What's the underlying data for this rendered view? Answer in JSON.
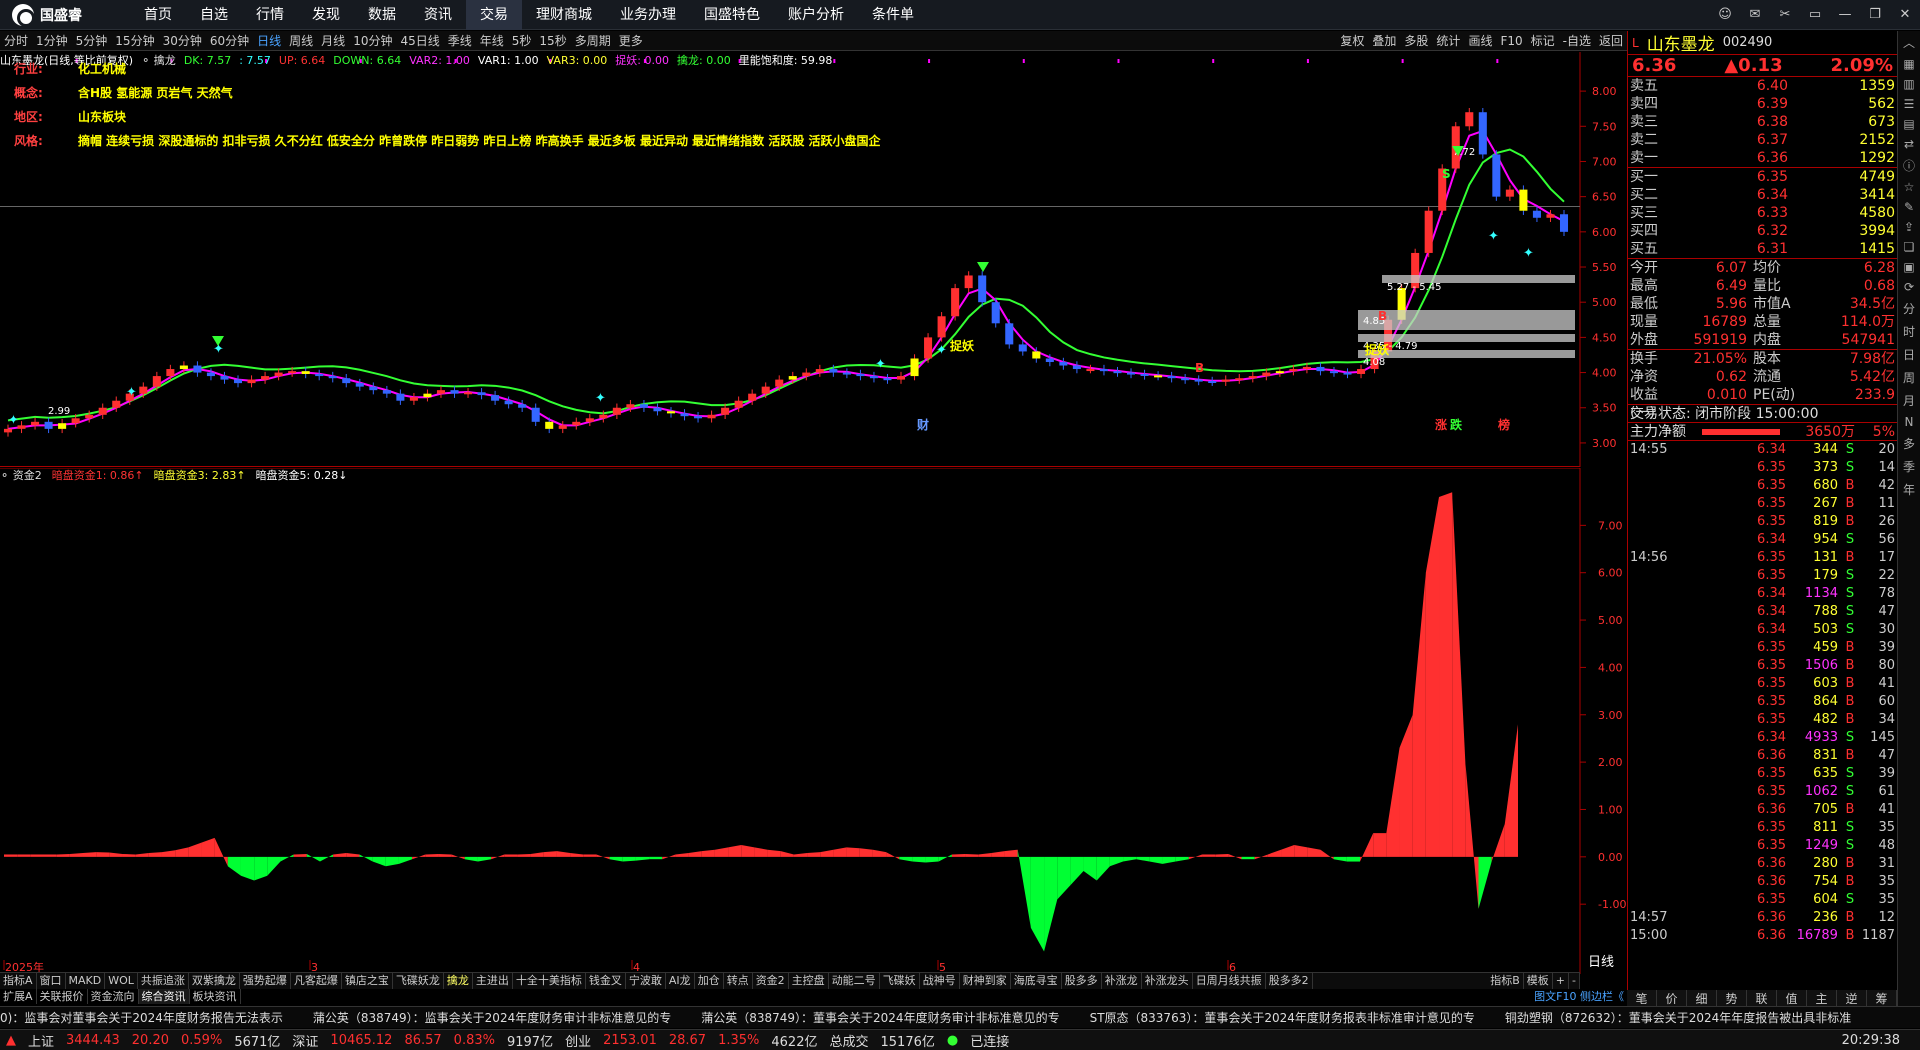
{
  "app": {
    "logo_text": "国盛睿"
  },
  "nav": [
    "首页",
    "自选",
    "行情",
    "发现",
    "数据",
    "资讯",
    "交易",
    "理财商城",
    "业务办理",
    "国盛特色",
    "账户分析",
    "条件单"
  ],
  "nav_active": 6,
  "window_icons": [
    "chat-icon",
    "mail-icon",
    "tools-icon",
    "screen-icon",
    "minimize-icon",
    "restore-icon",
    "close-icon"
  ],
  "periods": [
    "分时",
    "1分钟",
    "5分钟",
    "15分钟",
    "30分钟",
    "60分钟",
    "日线",
    "周线",
    "月线",
    "10分钟",
    "45日线",
    "季线",
    "年线",
    "5秒",
    "15秒",
    "多周期",
    "更多"
  ],
  "period_selected": 6,
  "tools": [
    "复权",
    "叠加",
    "多股",
    "统计",
    "画线",
    "F10",
    "标记",
    "-自选",
    "返回"
  ],
  "main_title": [
    {
      "t": "山东墨龙(日线,等比前复权)",
      "c": "#ffffff"
    },
    {
      "t": "⚬ 擒龙",
      "c": "#dddddd"
    },
    {
      "t": "DK: 7.57",
      "c": "#33ff33"
    },
    {
      "t": ": 7.57",
      "c": "#33ffff"
    },
    {
      "t": "UP: 6.64",
      "c": "#ff3333"
    },
    {
      "t": "DOWN: 6.64",
      "c": "#33ff33"
    },
    {
      "t": "VAR2: 1.00",
      "c": "#ff33ff"
    },
    {
      "t": "VAR1: 1.00",
      "c": "#ffffff"
    },
    {
      "t": "VAR3: 0.00",
      "c": "#ffff33"
    },
    {
      "t": "捉妖: 0.00",
      "c": "#ff33ff"
    },
    {
      "t": "擒龙: 0.00",
      "c": "#33ff33"
    },
    {
      "t": "里能饱和度: 59.98",
      "c": "#ffffff"
    }
  ],
  "stock_info": [
    {
      "k": "行业:",
      "v": "化工机械"
    },
    {
      "k": "概念:",
      "v": "含H股 氢能源 页岩气 天然气"
    },
    {
      "k": "地区:",
      "v": "山东板块"
    },
    {
      "k": "风格:",
      "v": "摘帽 连续亏损 深股通标的 扣非亏损 久不分红 低安全分 昨曾跌停 昨日弱势 昨日上榜 昨高换手 最近多板 最近异动 最近情绪指数 活跃股 活跃小盘国企"
    }
  ],
  "main_axis_ticks": [
    "8.00",
    "7.50",
    "7.00",
    "6.50",
    "6.00",
    "5.50",
    "5.00",
    "4.50",
    "4.00",
    "3.50",
    "3.00"
  ],
  "price_labels": {
    "high": "7.72",
    "low": "2.99",
    "box1": "5.27 - 5.45",
    "box2": "4.85",
    "box3": "4.35 - 4.79",
    "box4": "4.08"
  },
  "chart_markers": {
    "yao1": "捉妖",
    "yao2": "捉妖",
    "cai": "财",
    "zhang": "涨",
    "die": "跌",
    "bang": "榜",
    "b1": "B",
    "b2": "B",
    "s": "S",
    "b3": "B"
  },
  "sub_title": [
    {
      "t": "⚬ 资金2",
      "c": "#dddddd"
    },
    {
      "t": "暗盘资金1: 0.86↑",
      "c": "#ff3333"
    },
    {
      "t": "暗盘资金3: 2.83↑",
      "c": "#ffff33"
    },
    {
      "t": "暗盘资金5: 0.28↓",
      "c": "#ffffff"
    }
  ],
  "sub_axis_ticks": [
    "7.00",
    "6.00",
    "5.00",
    "4.00",
    "3.00",
    "2.00",
    "1.00",
    "0.00",
    "-1.00"
  ],
  "date_labels": [
    "2025年",
    "3",
    "4",
    "5",
    "6"
  ],
  "period_label": "日线",
  "indicator_tabs": [
    "指标A",
    "窗口",
    "MAKD",
    "WOL",
    "共振追涨",
    "双紫擒龙",
    "强势起爆",
    "凡客起爆",
    "镇店之宝",
    "飞碟妖龙",
    "擒龙",
    "主进出",
    "十全十美指标",
    "钱金叉",
    "宁波敢",
    "AI龙",
    "加仓",
    "转点",
    "资金2",
    "主控盘",
    "动能二号",
    "飞碟妖",
    "战神号",
    "财神到家",
    "海底寻宝",
    "股多多",
    "补涨龙",
    "补涨龙头",
    "日周月线共振",
    "股多多2"
  ],
  "indicator_selected": 10,
  "indicator_right": [
    "指标B",
    "模板",
    "+",
    "-"
  ],
  "bottom_tabs": [
    "扩展A",
    "关联报价",
    "资金流向",
    "综合资讯",
    "板块资讯"
  ],
  "bottom_tab_selected": 3,
  "bottom_right": "图文F10 侧边栏《",
  "news": [
    "0)：监事会对董事会关于2024年度财务报告无法表示",
    "蒲公英（838749）：监事会关于2024年度财务审计非标准意见的专",
    "蒲公英（838749）：董事会关于2024年度财务审计非标准意见的专",
    "ST原态（833763）：董事会关于2024年度财务报表非标准审计意见的专",
    "铜劲塑钢（872632）：董事会关于2024年年度报告被出具非标准"
  ],
  "status": {
    "sh": {
      "name": "上证",
      "v": "3444.43",
      "chg": "20.20",
      "pct": "0.59%",
      "amt": "5671亿"
    },
    "sz": {
      "name": "深证",
      "v": "10465.12",
      "chg": "86.57",
      "pct": "0.83%",
      "amt": "9197亿"
    },
    "cy": {
      "name": "创业",
      "v": "2153.01",
      "chg": "28.67",
      "pct": "1.35%",
      "amt": "4622亿"
    },
    "total_label": "总成交",
    "total": "15176亿",
    "conn": "已连接",
    "time": "20:29:38"
  },
  "quote": {
    "flag": "L",
    "name": "山东墨龙",
    "code": "002490",
    "price": "6.36",
    "change": "▲0.13",
    "pct": "2.09%",
    "asks": [
      {
        "l": "卖五",
        "p": "6.40",
        "q": "1359"
      },
      {
        "l": "卖四",
        "p": "6.39",
        "q": "562"
      },
      {
        "l": "卖三",
        "p": "6.38",
        "q": "673"
      },
      {
        "l": "卖二",
        "p": "6.37",
        "q": "2152"
      },
      {
        "l": "卖一",
        "p": "6.36",
        "q": "1292"
      }
    ],
    "bids": [
      {
        "l": "买一",
        "p": "6.35",
        "q": "4749"
      },
      {
        "l": "买二",
        "p": "6.34",
        "q": "3414"
      },
      {
        "l": "买三",
        "p": "6.33",
        "q": "4580"
      },
      {
        "l": "买四",
        "p": "6.32",
        "q": "3994"
      },
      {
        "l": "买五",
        "p": "6.31",
        "q": "1415"
      }
    ],
    "stats": [
      {
        "a": "今开",
        "b": "6.07",
        "c": "均价",
        "d": "6.28"
      },
      {
        "a": "最高",
        "b": "6.49",
        "c": "量比",
        "d": "0.68"
      },
      {
        "a": "最低",
        "b": "5.96",
        "c": "市值A",
        "d": "34.5亿"
      },
      {
        "a": "现量",
        "b": "16789",
        "c": "总量",
        "d": "114.0万"
      },
      {
        "a": "外盘",
        "b": "591919",
        "c": "内盘",
        "d": "547941"
      }
    ],
    "stats2": [
      {
        "a": "换手",
        "b": "21.05%",
        "c": "股本",
        "d": "7.98亿"
      },
      {
        "a": "净资",
        "b": "0.62",
        "c": "流通",
        "d": "5.42亿"
      },
      {
        "a": "收益(一)",
        "b": "0.010",
        "c": "PE(动)",
        "d": "233.9"
      }
    ],
    "trade_status": "交易状态: 闭市阶段 15:00:00",
    "main_net_label": "主力净额",
    "main_net": "3650万",
    "main_net_pct": "5%"
  },
  "ticks": [
    {
      "t": "14:55",
      "p": "6.34",
      "v": "344",
      "s": "S",
      "n": "20"
    },
    {
      "t": "",
      "p": "6.35",
      "v": "373",
      "s": "S",
      "n": "14"
    },
    {
      "t": "",
      "p": "6.35",
      "v": "680",
      "s": "B",
      "n": "42"
    },
    {
      "t": "",
      "p": "6.35",
      "v": "267",
      "s": "B",
      "n": "11"
    },
    {
      "t": "",
      "p": "6.35",
      "v": "819",
      "s": "B",
      "n": "26"
    },
    {
      "t": "",
      "p": "6.34",
      "v": "954",
      "s": "S",
      "n": "56"
    },
    {
      "t": "14:56",
      "p": "6.35",
      "v": "131",
      "s": "B",
      "n": "17"
    },
    {
      "t": "",
      "p": "6.35",
      "v": "179",
      "s": "S",
      "n": "22"
    },
    {
      "t": "",
      "p": "6.34",
      "v": "1134",
      "s": "S",
      "n": "78"
    },
    {
      "t": "",
      "p": "6.34",
      "v": "788",
      "s": "S",
      "n": "47"
    },
    {
      "t": "",
      "p": "6.34",
      "v": "503",
      "s": "S",
      "n": "30"
    },
    {
      "t": "",
      "p": "6.35",
      "v": "459",
      "s": "B",
      "n": "39"
    },
    {
      "t": "",
      "p": "6.35",
      "v": "1506",
      "s": "B",
      "n": "80"
    },
    {
      "t": "",
      "p": "6.35",
      "v": "603",
      "s": "B",
      "n": "41"
    },
    {
      "t": "",
      "p": "6.35",
      "v": "864",
      "s": "B",
      "n": "60"
    },
    {
      "t": "",
      "p": "6.35",
      "v": "482",
      "s": "B",
      "n": "34"
    },
    {
      "t": "",
      "p": "6.34",
      "v": "4933",
      "s": "S",
      "n": "145"
    },
    {
      "t": "",
      "p": "6.36",
      "v": "831",
      "s": "B",
      "n": "47"
    },
    {
      "t": "",
      "p": "6.35",
      "v": "635",
      "s": "S",
      "n": "39"
    },
    {
      "t": "",
      "p": "6.35",
      "v": "1062",
      "s": "S",
      "n": "61"
    },
    {
      "t": "",
      "p": "6.36",
      "v": "705",
      "s": "B",
      "n": "41"
    },
    {
      "t": "",
      "p": "6.35",
      "v": "811",
      "s": "S",
      "n": "35"
    },
    {
      "t": "",
      "p": "6.35",
      "v": "1249",
      "s": "S",
      "n": "48"
    },
    {
      "t": "",
      "p": "6.36",
      "v": "280",
      "s": "B",
      "n": "31"
    },
    {
      "t": "",
      "p": "6.36",
      "v": "754",
      "s": "B",
      "n": "35"
    },
    {
      "t": "",
      "p": "6.35",
      "v": "604",
      "s": "S",
      "n": "35"
    },
    {
      "t": "14:57",
      "p": "6.36",
      "v": "236",
      "s": "B",
      "n": "12"
    },
    {
      "t": "15:00",
      "p": "6.36",
      "v": "16789",
      "s": "B",
      "n": "1187"
    }
  ],
  "right_tabs": [
    "笔",
    "价",
    "细",
    "势",
    "联",
    "值",
    "主",
    "逆",
    "筹"
  ],
  "side_icons": [
    "up-arrow-icon",
    "grid-icon",
    "chart-icon",
    "list-icon",
    "calendar-icon",
    "compare-icon",
    "info-icon",
    "star-icon",
    "edit-icon",
    "share-icon",
    "book-icon",
    "layers-icon",
    "refresh-icon"
  ],
  "side_labels": [
    "分",
    "时",
    "日",
    "周",
    "月",
    "N",
    "多",
    "季",
    "年"
  ],
  "colors": {
    "up": "#ff3030",
    "down": "#00ff33",
    "ma1": "#ff00ff",
    "ma2": "#33ff33",
    "bg": "#000000",
    "axis": "#aa0000"
  },
  "chart_data": [
    {
      "type": "candlestick",
      "ylim": [
        2.8,
        8.3
      ],
      "yticks": [
        3.0,
        3.5,
        4.0,
        4.5,
        5.0,
        5.5,
        6.0,
        6.5,
        7.0,
        7.5,
        8.0
      ],
      "close": [
        3.2,
        3.25,
        3.3,
        3.2,
        3.28,
        3.35,
        3.4,
        3.5,
        3.6,
        3.7,
        3.8,
        3.95,
        4.05,
        4.1,
        4.0,
        3.95,
        3.9,
        3.85,
        3.9,
        3.95,
        4.0,
        4.02,
        3.98,
        3.95,
        3.92,
        3.85,
        3.8,
        3.75,
        3.7,
        3.6,
        3.65,
        3.7,
        3.75,
        3.7,
        3.72,
        3.68,
        3.6,
        3.55,
        3.5,
        3.3,
        3.2,
        3.25,
        3.3,
        3.35,
        3.4,
        3.5,
        3.55,
        3.5,
        3.45,
        3.42,
        3.38,
        3.35,
        3.4,
        3.5,
        3.6,
        3.7,
        3.8,
        3.9,
        3.95,
        4.0,
        4.05,
        4.0,
        3.98,
        3.95,
        3.92,
        3.9,
        3.95,
        4.2,
        4.5,
        4.8,
        5.2,
        5.38,
        5.0,
        4.7,
        4.4,
        4.3,
        4.2,
        4.15,
        4.1,
        4.05,
        4.05,
        4.02,
        4.0,
        3.98,
        3.96,
        3.95,
        3.92,
        3.9,
        3.88,
        3.87,
        3.9,
        3.92,
        3.95,
        4.0,
        4.02,
        4.05,
        4.08,
        4.02,
        4.0,
        3.98,
        4.05,
        4.3,
        4.75,
        5.2,
        5.7,
        6.3,
        6.9,
        7.5,
        7.7,
        7.1,
        6.5,
        6.6,
        6.3,
        6.2,
        6.25,
        6.0
      ]
    },
    {
      "type": "area",
      "ylim": [
        -2.2,
        8.0
      ],
      "yticks": [
        -1,
        0,
        1,
        2,
        3,
        4,
        5,
        6,
        7
      ],
      "values": [
        0.05,
        0.05,
        0.05,
        0.05,
        0.05,
        0.06,
        0.08,
        0.1,
        0.09,
        0.06,
        0.05,
        0.08,
        0.1,
        0.14,
        0.2,
        0.3,
        0.4,
        -0.2,
        -0.4,
        -0.5,
        -0.4,
        -0.1,
        0.05,
        0.06,
        -0.1,
        0.05,
        0.08,
        0.05,
        -0.1,
        -0.2,
        -0.15,
        -0.05,
        0.05,
        0.06,
        0.05,
        -0.05,
        -0.1,
        -0.05,
        0.05,
        0.05,
        0.06,
        0.1,
        0.12,
        0.08,
        0.05,
        0.05,
        -0.05,
        -0.1,
        -0.08,
        -0.05,
        -0.05,
        0.05,
        0.08,
        0.12,
        0.15,
        0.2,
        0.25,
        0.2,
        0.15,
        0.12,
        0.05,
        0.08,
        0.1,
        0.15,
        0.2,
        0.18,
        0.15,
        0.1,
        -0.05,
        -0.1,
        -0.12,
        -0.1,
        0.05,
        0.06,
        0.05,
        0.08,
        0.12,
        0.15,
        -1.5,
        -2.0,
        -0.9,
        -0.6,
        -0.3,
        -0.5,
        -0.2,
        -0.1,
        -0.05,
        -0.1,
        -0.15,
        -0.1,
        -0.05,
        0.05,
        0.05,
        0.06,
        -0.05,
        -0.05,
        0.05,
        0.15,
        0.25,
        0.2,
        0.15,
        -0.05,
        -0.1,
        -0.1,
        0.5,
        0.5,
        2.3,
        3.0,
        6.0,
        7.6,
        7.7,
        2.0,
        -1.1,
        -0.1,
        0.7,
        2.8
      ]
    }
  ]
}
